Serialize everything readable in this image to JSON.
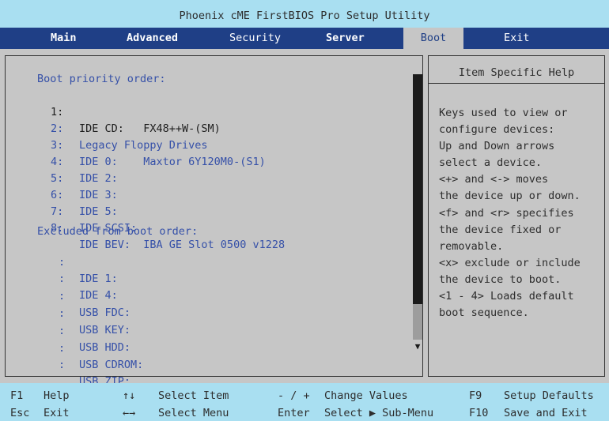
{
  "title": "Phoenix cME FirstBIOS Pro Setup Utility",
  "menu": {
    "main": "Main",
    "advanced": "Advanced",
    "security": "Security",
    "server": "Server",
    "boot": "Boot",
    "exit": "Exit"
  },
  "boot": {
    "priority_header": "Boot priority order:",
    "priority": [
      {
        "num": "1:",
        "text": "IDE CD:   FX48++W-(SM)"
      },
      {
        "num": "2:",
        "text": "Legacy Floppy Drives"
      },
      {
        "num": "3:",
        "text": "IDE 0:    Maxtor 6Y120M0-(S1)"
      },
      {
        "num": "4:",
        "text": "IDE 2:"
      },
      {
        "num": "5:",
        "text": "IDE 3:"
      },
      {
        "num": "6:",
        "text": "IDE 5:"
      },
      {
        "num": "7:",
        "text": "IDE SCSI:"
      },
      {
        "num": "8:",
        "text": "IDE BEV:  IBA GE Slot 0500 v1228"
      }
    ],
    "excluded_header": "Excluded from boot order:",
    "excluded": [
      {
        "num": ":",
        "text": "IDE 1:"
      },
      {
        "num": ":",
        "text": "IDE 4:"
      },
      {
        "num": ":",
        "text": "USB FDC:"
      },
      {
        "num": ":",
        "text": "USB KEY:"
      },
      {
        "num": ":",
        "text": "USB HDD:"
      },
      {
        "num": ":",
        "text": "USB CDROM:"
      },
      {
        "num": ":",
        "text": "USB ZIP:"
      }
    ],
    "scroll_arrow_icon": "arrow-down-triangle"
  },
  "help": {
    "title": "Item Specific Help",
    "lines": [
      "Keys used to view or",
      "configure devices:",
      "Up and Down arrows",
      "select a device.",
      "<+> and <-> moves",
      "the device up or down.",
      "<f> and <r> specifies",
      "the device fixed or",
      "removable.",
      "<x> exclude or include",
      "the device to boot.",
      "<1 - 4> Loads default",
      "boot sequence."
    ]
  },
  "footer": {
    "row1": [
      {
        "key": "F1",
        "label": "Help"
      },
      {
        "key": "↑↓",
        "label": "Select Item"
      },
      {
        "key": "- / +",
        "label": "Change Values"
      },
      {
        "key": "F9",
        "label": "Setup Defaults"
      }
    ],
    "row2": [
      {
        "key": "Esc",
        "label": "Exit"
      },
      {
        "key": "←→",
        "label": "Select Menu"
      },
      {
        "key": "Enter",
        "label": "Select ▶ Sub-Menu"
      },
      {
        "key": "F10",
        "label": "Save and Exit"
      }
    ]
  },
  "colors": {
    "title_bg": "#a9dff1",
    "menu_bg": "#1f3f86",
    "panel_bg": "#c6c6c6",
    "item_text": "#3550a8",
    "selected_text": "#1e1e1e"
  }
}
